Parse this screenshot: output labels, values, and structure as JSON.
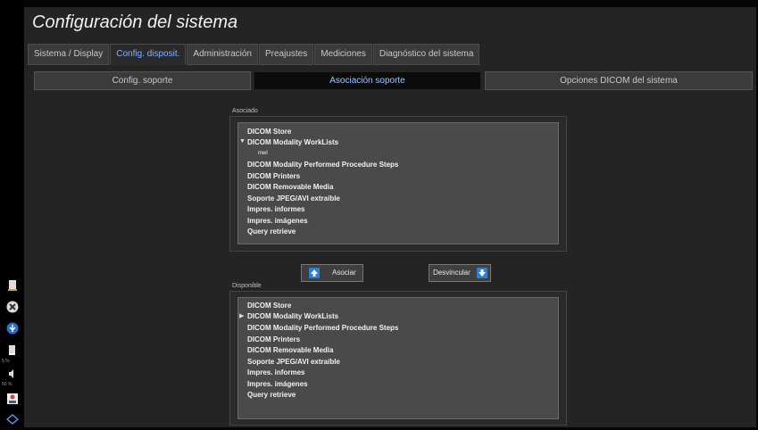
{
  "title": "Configuración del sistema",
  "tabs": [
    {
      "label": "Sistema / Display"
    },
    {
      "label": "Config. disposit."
    },
    {
      "label": "Administración"
    },
    {
      "label": "Preajustes"
    },
    {
      "label": "Mediciones"
    },
    {
      "label": "Diagnóstico del sistema"
    }
  ],
  "active_tab": "Config. disposit.",
  "subtabs": [
    {
      "label": "Config. soporte"
    },
    {
      "label": "Asociación soporte"
    },
    {
      "label": "Opciones DICOM del sistema"
    }
  ],
  "active_subtab": "Asociación soporte",
  "asociado": {
    "title": "Asociado",
    "items": [
      "DICOM Store",
      "DICOM Modality WorkLists",
      "mwl",
      "DICOM Modality Performed Procedure Steps",
      "DICOM Printers",
      "DICOM Removable Media",
      "Soporte JPEG/AVI extraíble",
      "Impres. informes",
      "Impres. imágenes",
      "Query retrieve"
    ]
  },
  "disponible": {
    "title": "Disponible",
    "items": [
      "DICOM Store",
      "DICOM Modality WorkLists",
      "DICOM Modality Performed Procedure Steps",
      "DICOM Printers",
      "DICOM Removable Media",
      "Soporte JPEG/AVI extraíble",
      "Impres. informes",
      "Impres. imágenes",
      "Query retrieve"
    ]
  },
  "buttons": {
    "asociar": "Asociar",
    "desvincular": "Desvincular"
  },
  "side": {
    "battery_pct": "5 %",
    "volume_pct": "50 %"
  },
  "colors": {
    "accent": "#7fb3ff",
    "arrow_blue": "#2d7fd6"
  }
}
